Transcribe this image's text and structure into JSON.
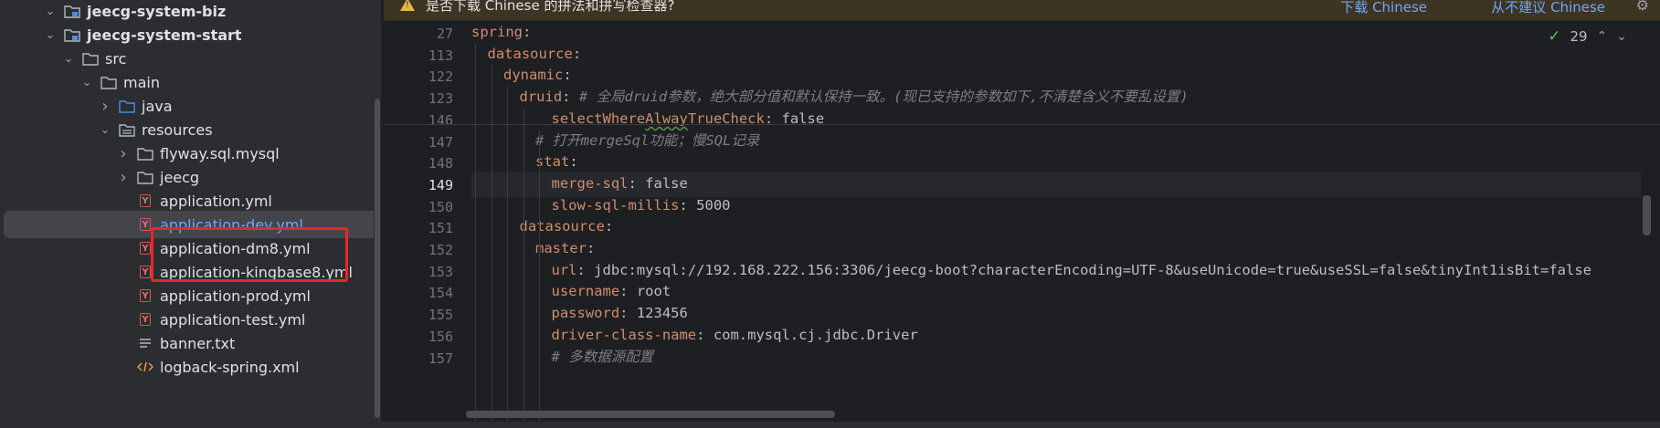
{
  "project_tree": {
    "items": [
      {
        "label": "jeecg-system-biz",
        "type": "module",
        "indent": 2,
        "chevron": "down",
        "bold": true
      },
      {
        "label": "jeecg-system-start",
        "type": "module",
        "indent": 2,
        "chevron": "down",
        "bold": true
      },
      {
        "label": "src",
        "type": "folder",
        "indent": 3,
        "chevron": "down"
      },
      {
        "label": "main",
        "type": "folder",
        "indent": 4,
        "chevron": "down"
      },
      {
        "label": "java",
        "type": "source-folder",
        "indent": 5,
        "chevron": "right"
      },
      {
        "label": "resources",
        "type": "resources-folder",
        "indent": 5,
        "chevron": "down"
      },
      {
        "label": "flyway.sql.mysql",
        "type": "folder",
        "indent": 6,
        "chevron": "right"
      },
      {
        "label": "jeecg",
        "type": "folder",
        "indent": 6,
        "chevron": "right"
      },
      {
        "label": "application.yml",
        "type": "yml",
        "indent": 6,
        "chevron": "none"
      },
      {
        "label": "application-dev.yml",
        "type": "yml",
        "indent": 6,
        "chevron": "none",
        "selected": true
      },
      {
        "label": "application-dm8.yml",
        "type": "yml",
        "indent": 6,
        "chevron": "none"
      },
      {
        "label": "application-kingbase8.yml",
        "type": "yml",
        "indent": 6,
        "chevron": "none"
      },
      {
        "label": "application-prod.yml",
        "type": "yml",
        "indent": 6,
        "chevron": "none"
      },
      {
        "label": "application-test.yml",
        "type": "yml",
        "indent": 6,
        "chevron": "none"
      },
      {
        "label": "banner.txt",
        "type": "text",
        "indent": 6,
        "chevron": "none"
      },
      {
        "label": "logback-spring.xml",
        "type": "xml",
        "indent": 6,
        "chevron": "none"
      }
    ]
  },
  "banner": {
    "message": "是否下载 Chinese 的拼法和拼写检查器?",
    "download_label": "下载 Chinese",
    "never_label": "从不建议 Chinese"
  },
  "inspection": {
    "count": "29"
  },
  "editor": {
    "current_line": "149",
    "lines": [
      {
        "num": "27",
        "indent": 0,
        "key": "spring",
        "sep": ":",
        "value": "",
        "comment": ""
      },
      {
        "num": "113",
        "indent": 1,
        "key": "datasource",
        "sep": ":",
        "value": "",
        "comment": ""
      },
      {
        "num": "122",
        "indent": 2,
        "key": "dynamic",
        "sep": ":",
        "value": "",
        "comment": ""
      },
      {
        "num": "123",
        "indent": 3,
        "key": "druid",
        "sep": ": ",
        "value": "",
        "comment": "# 全局druid参数，绝大部分值和默认保持一致。(现已支持的参数如下,不清楚含义不要乱设置)"
      },
      {
        "num": "146",
        "indent": 5,
        "key": "selectWhereAlwayTrueCheck",
        "sep": ": ",
        "value": "false",
        "comment": ""
      },
      {
        "num": "147",
        "indent": 4,
        "key": "",
        "sep": "",
        "value": "",
        "comment": "# 打开mergeSql功能；慢SQL记录"
      },
      {
        "num": "148",
        "indent": 4,
        "key": "stat",
        "sep": ":",
        "value": "",
        "comment": ""
      },
      {
        "num": "149",
        "indent": 5,
        "key": "merge-sql",
        "sep": ": ",
        "value": "false",
        "comment": ""
      },
      {
        "num": "150",
        "indent": 5,
        "key": "slow-sql-millis",
        "sep": ": ",
        "value": "5000",
        "comment": ""
      },
      {
        "num": "151",
        "indent": 3,
        "key": "datasource",
        "sep": ":",
        "value": "",
        "comment": ""
      },
      {
        "num": "152",
        "indent": 4,
        "key": "master",
        "sep": ":",
        "value": "",
        "comment": ""
      },
      {
        "num": "153",
        "indent": 5,
        "key": "url",
        "sep": ": ",
        "value": "jdbc:mysql://192.168.222.156:3306/jeecg-boot?characterEncoding=UTF-8&useUnicode=true&useSSL=false&tinyInt1isBit=false",
        "comment": ""
      },
      {
        "num": "154",
        "indent": 5,
        "key": "username",
        "sep": ": ",
        "value": "root",
        "comment": ""
      },
      {
        "num": "155",
        "indent": 5,
        "key": "password",
        "sep": ": ",
        "value": "123456",
        "comment": ""
      },
      {
        "num": "156",
        "indent": 5,
        "key": "driver-class-name",
        "sep": ": ",
        "value": "com.mysql.cj.jdbc.Driver",
        "comment": ""
      },
      {
        "num": "157",
        "indent": 5,
        "key": "",
        "sep": "",
        "value": "",
        "comment": "# 多数据源配置"
      }
    ]
  },
  "colors": {
    "yaml_key": "#cf8e6d",
    "comment": "#7a7e85",
    "selection_text": "#6ea8ff",
    "highlight_box": "#e8262b",
    "editor_bg": "#1e1f22",
    "panel_bg": "#2b2d30",
    "banner_bg": "#3d3423"
  }
}
